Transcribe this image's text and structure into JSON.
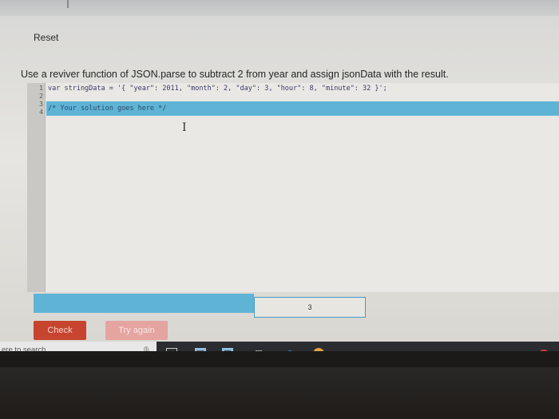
{
  "page": {
    "reset_label": "Reset",
    "prompt": "Use a reviver function of JSON.parse to subtract 2 from year and assign jsonData with the result."
  },
  "editor": {
    "line_numbers": [
      "1",
      "2",
      "3",
      "4"
    ],
    "lines": [
      "var stringData = '{ \"year\": 2011, \"month\": 2, \"day\": 3, \"hour\": 8, \"minute\": 32 }';",
      "",
      "/* Your solution goes here */",
      ""
    ]
  },
  "result": {
    "count": "3"
  },
  "buttons": {
    "check": "Check",
    "try_again": "Try again"
  },
  "taskbar": {
    "search_placeholder": "ere to search",
    "mic_icon": "microphone-icon"
  },
  "colors": {
    "highlight": "#5fb4d6",
    "check_button": "#c7442e",
    "try_again_button": "#e5a4a0",
    "taskbar": "#2b2c30"
  }
}
